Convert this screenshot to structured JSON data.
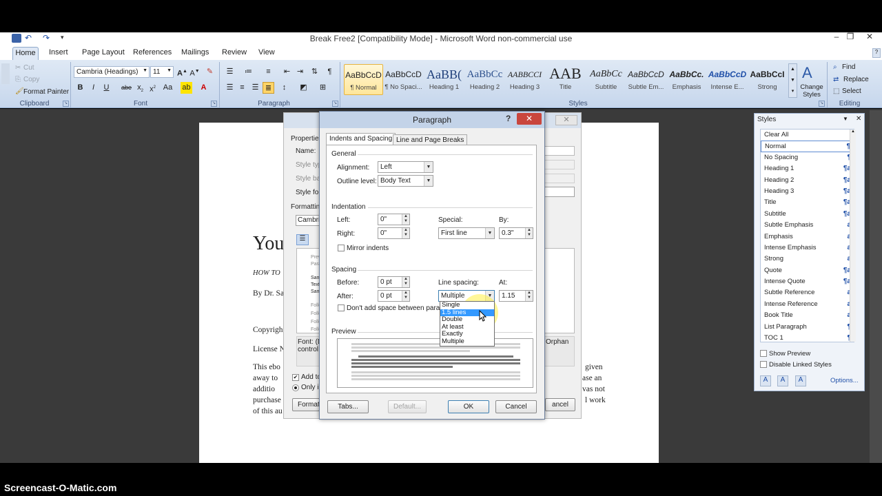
{
  "window": {
    "title": "Break Free2 [Compatibility Mode] - Microsoft Word non-commercial use",
    "controls": [
      "–",
      "❐",
      "✕"
    ]
  },
  "ribbon": {
    "tabs": [
      "Home",
      "Insert",
      "Page Layout",
      "References",
      "Mailings",
      "Review",
      "View"
    ],
    "clipboard": {
      "cut": "Cut",
      "copy": "Copy",
      "format_painter": "Format Painter",
      "label": "Clipboard"
    },
    "font": {
      "name": "Cambria (Headings)",
      "size": "11",
      "label": "Font"
    },
    "paragraph": {
      "label": "Paragraph"
    },
    "styles": {
      "label": "Styles",
      "tiles": [
        {
          "sample": "AaBbCcD",
          "name": "¶ Normal"
        },
        {
          "sample": "AaBbCcD",
          "name": "¶ No Spaci..."
        },
        {
          "sample": "AaBB(",
          "name": "Heading 1"
        },
        {
          "sample": "AaBbCc",
          "name": "Heading 2"
        },
        {
          "sample": "AABBCCI",
          "name": "Heading 3"
        },
        {
          "sample": "AAB",
          "name": "Title"
        },
        {
          "sample": "AaBbCc",
          "name": "Subtitle"
        },
        {
          "sample": "AaBbCcD",
          "name": "Subtle Em..."
        },
        {
          "sample": "AaBbCc.",
          "name": "Emphasis"
        },
        {
          "sample": "AaBbCcD",
          "name": "Intense E..."
        },
        {
          "sample": "AaBbCcI",
          "name": "Strong"
        }
      ],
      "change_styles": "Change Styles"
    },
    "editing": {
      "find": "Find",
      "replace": "Replace",
      "select": "Select",
      "label": "Editing"
    }
  },
  "document": {
    "heading": "You",
    "subheading": "HOW TO",
    "byline": "By Dr. Sa",
    "copyright": "Copyrigh",
    "license": "License N",
    "body": [
      "This ebo",
      "away to",
      "additio",
      "purchase",
      "of this au"
    ],
    "right_body": [
      "given",
      "ase an",
      "vas not",
      "l work"
    ]
  },
  "modify_style": {
    "properties": "Properties",
    "name_label": "Name:",
    "style_type": "Style typ",
    "style_based": "Style bas",
    "style_for": "Style for",
    "formatting": "Formatting",
    "font": "Cambria",
    "preview_lines": [
      "Previ",
      "Parag",
      "Sam",
      "Text",
      "Sam",
      "Follo",
      "Follo",
      "Follo",
      "Follo"
    ],
    "desc": "Font: (D",
    "desc2": "control,",
    "desc_right": "Orphan",
    "add_to": "Add to",
    "only_in": "Only in",
    "format_btn": "Format",
    "cancel_btn": "ancel"
  },
  "paragraph_dialog": {
    "title": "Paragraph",
    "help": "?",
    "tabs": [
      "Indents and Spacing",
      "Line and Page Breaks"
    ],
    "general": {
      "label": "General",
      "alignment_label": "Alignment:",
      "alignment": "Left",
      "outline_label": "Outline level:",
      "outline": "Body Text"
    },
    "indentation": {
      "label": "Indentation",
      "left_label": "Left:",
      "left": "0\"",
      "right_label": "Right:",
      "right": "0\"",
      "special_label": "Special:",
      "special": "First line",
      "by_label": "By:",
      "by": "0.3\"",
      "mirror": "Mirror indents"
    },
    "spacing": {
      "label": "Spacing",
      "before_label": "Before:",
      "before": "0 pt",
      "after_label": "After:",
      "after": "0 pt",
      "line_label": "Line spacing:",
      "line": "Multiple",
      "at_label": "At:",
      "at": "1.15",
      "dont_add": "Don't add space between paragra"
    },
    "line_spacing_options": [
      "Single",
      "1.5 lines",
      "Double",
      "At least",
      "Exactly",
      "Multiple"
    ],
    "highlighted_option": "1.5 lines",
    "preview_label": "Preview",
    "buttons": {
      "tabs": "Tabs...",
      "default": "Default...",
      "ok": "OK",
      "cancel": "Cancel"
    }
  },
  "styles_pane": {
    "title": "Styles",
    "items": [
      {
        "name": "Clear All",
        "mark": ""
      },
      {
        "name": "Normal",
        "mark": "¶"
      },
      {
        "name": "No Spacing",
        "mark": "¶"
      },
      {
        "name": "Heading 1",
        "mark": "¶a"
      },
      {
        "name": "Heading 2",
        "mark": "¶a"
      },
      {
        "name": "Heading 3",
        "mark": "¶a"
      },
      {
        "name": "Title",
        "mark": "¶a"
      },
      {
        "name": "Subtitle",
        "mark": "¶a"
      },
      {
        "name": "Subtle Emphasis",
        "mark": "a"
      },
      {
        "name": "Emphasis",
        "mark": "a"
      },
      {
        "name": "Intense Emphasis",
        "mark": "a"
      },
      {
        "name": "Strong",
        "mark": "a"
      },
      {
        "name": "Quote",
        "mark": "¶a"
      },
      {
        "name": "Intense Quote",
        "mark": "¶a"
      },
      {
        "name": "Subtle Reference",
        "mark": "a"
      },
      {
        "name": "Intense Reference",
        "mark": "a"
      },
      {
        "name": "Book Title",
        "mark": "a"
      },
      {
        "name": "List Paragraph",
        "mark": "¶"
      },
      {
        "name": "TOC 1",
        "mark": "¶"
      }
    ],
    "active": "Normal",
    "show_preview": "Show Preview",
    "disable_linked": "Disable Linked Styles",
    "options": "Options..."
  },
  "watermark": "Screencast-O-Matic.com",
  "colors": {
    "ribbon": "#c6d6ec",
    "highlight": "#3399ff",
    "close_red": "#c9463d"
  }
}
